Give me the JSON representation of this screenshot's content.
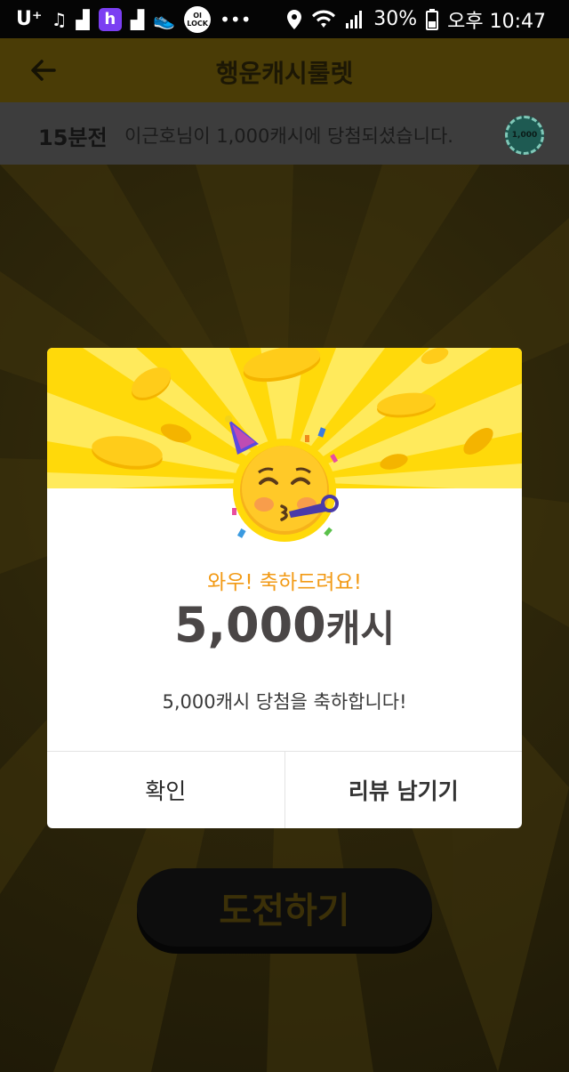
{
  "status_bar": {
    "carrier": "U⁺",
    "lock_app": "OI LOCK",
    "battery": "30%",
    "time": "오후 10:47"
  },
  "app_bar": {
    "title": "행운캐시룰렛"
  },
  "ticker": {
    "time_ago": "15분전",
    "message": "이근호님이 1,000캐시에 당첨되셨습니다.",
    "coin_label": "1,000"
  },
  "modal": {
    "congrats": "와우! 축하드려요!",
    "amount_number": "5,000",
    "amount_unit": "캐시",
    "description": "5,000캐시 당첨을 축하합니다!",
    "confirm_label": "확인",
    "review_label": "리뷰 남기기"
  },
  "main": {
    "challenge_label": "도전하기"
  },
  "colors": {
    "accent_yellow": "#ffd90a",
    "congrats_orange": "#f29a15",
    "amount_gray": "#4a4646"
  }
}
